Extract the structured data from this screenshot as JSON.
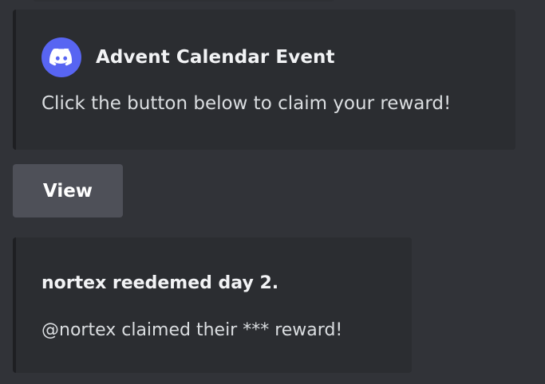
{
  "embed_reward_prompt": {
    "author_icon": "discord-logo-icon",
    "author_name": "Advent Calendar Event",
    "description": "Click the button below to claim your reward!"
  },
  "action_button": {
    "label": "View"
  },
  "embed_redeemed": {
    "title": "nortex reedemed day 2.",
    "description": "@nortex claimed their *** reward!"
  },
  "colors": {
    "background": "#313338",
    "embed_background": "#2b2d31",
    "embed_border": "#1e1f22",
    "avatar": "#5865f2",
    "button": "#4e5058",
    "title_text": "#f2f3f5",
    "body_text": "#dbdee1"
  }
}
